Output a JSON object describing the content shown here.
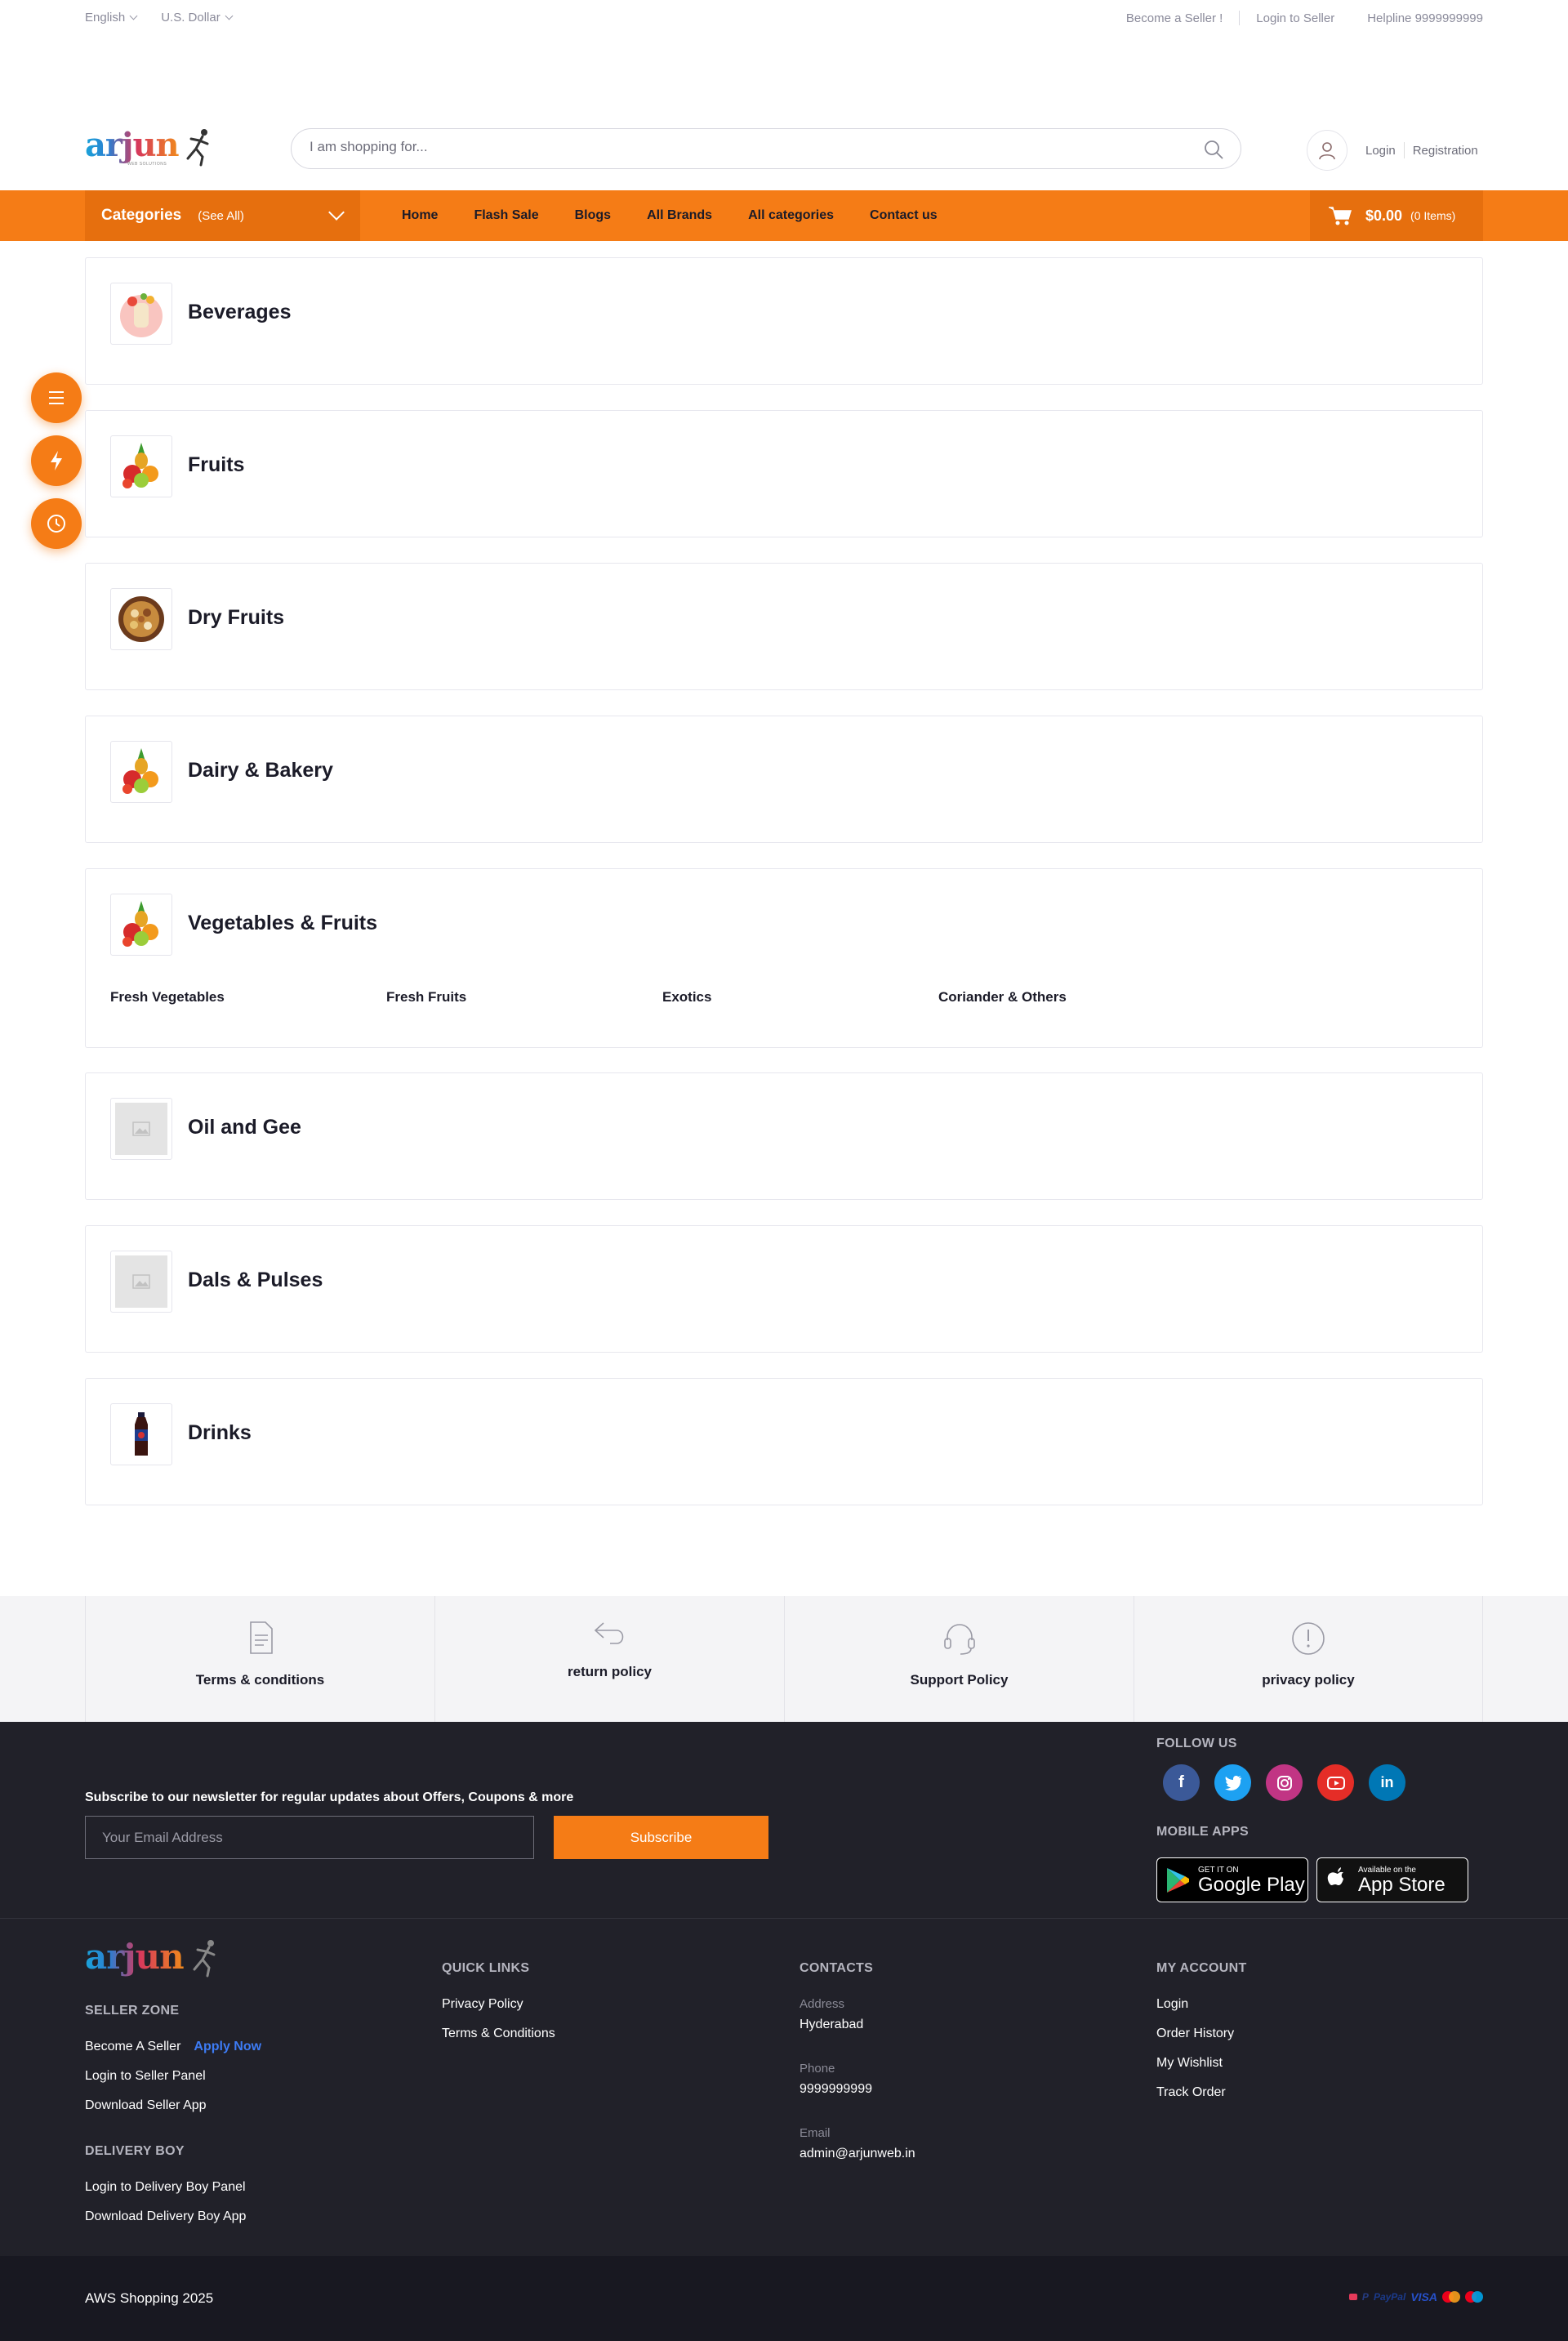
{
  "topbar": {
    "language": "English",
    "currency": "U.S. Dollar",
    "become_seller": "Become a Seller !",
    "login_seller": "Login to Seller",
    "helpline": "Helpline 9999999999"
  },
  "header": {
    "logo_text": "arjun",
    "logo_tagline": "WEB SOLUTIONS",
    "search_placeholder": "I am shopping for...",
    "login": "Login",
    "registration": "Registration"
  },
  "nav": {
    "categories": "Categories",
    "see_all": "(See All)",
    "links": [
      "Home",
      "Flash Sale",
      "Blogs",
      "All Brands",
      "All categories",
      "Contact us"
    ],
    "cart_amount": "$0.00",
    "cart_count": "(0 Items)"
  },
  "categories": [
    {
      "name": "Beverages",
      "icon": "beverages-image",
      "subs": []
    },
    {
      "name": "Fruits",
      "icon": "fruits-image",
      "subs": []
    },
    {
      "name": "Dry Fruits",
      "icon": "dry-fruits-image",
      "subs": []
    },
    {
      "name": "Dairy & Bakery",
      "icon": "fruits-image",
      "subs": []
    },
    {
      "name": "Vegetables & Fruits",
      "icon": "fruits-image",
      "subs": [
        "Fresh Vegetables",
        "Fresh Fruits",
        "Exotics",
        "Coriander & Others"
      ]
    },
    {
      "name": "Oil and Gee",
      "icon": "placeholder-image",
      "subs": []
    },
    {
      "name": "Dals & Pulses",
      "icon": "placeholder-image",
      "subs": []
    },
    {
      "name": "Drinks",
      "icon": "bottle-image",
      "subs": []
    }
  ],
  "policies": [
    "Terms & conditions",
    "return policy",
    "Support Policy",
    "privacy policy"
  ],
  "newsletter": {
    "title": "Subscribe to our newsletter for regular updates about Offers, Coupons & more",
    "placeholder": "Your Email Address",
    "button": "Subscribe"
  },
  "follow": {
    "title": "FOLLOW US",
    "networks": [
      "facebook",
      "twitter",
      "instagram",
      "youtube",
      "linkedin"
    ]
  },
  "apps": {
    "title": "MOBILE APPS",
    "google_small": "GET IT ON",
    "google_big": "Google Play",
    "apple_small": "Available on the",
    "apple_big": "App Store"
  },
  "footer": {
    "seller_zone": "SELLER ZONE",
    "become_seller": "Become A Seller",
    "apply_now": "Apply Now",
    "login_seller_panel": "Login to Seller Panel",
    "download_seller_app": "Download Seller App",
    "delivery_boy": "DELIVERY BOY",
    "login_delivery_panel": "Login to Delivery Boy Panel",
    "download_delivery_app": "Download Delivery Boy App",
    "quick_links": "QUICK LINKS",
    "privacy_policy": "Privacy Policy",
    "terms": "Terms & Conditions",
    "contacts": "CONTACTS",
    "address_label": "Address",
    "address": "Hyderabad",
    "phone_label": "Phone",
    "phone": "9999999999",
    "email_label": "Email",
    "email": "admin@arjunweb.in",
    "my_account": "MY ACCOUNT",
    "account_links": [
      "Login",
      "Order History",
      "My Wishlist",
      "Track Order"
    ]
  },
  "bottom": {
    "copyright": "AWS Shopping 2025",
    "paypal": "PayPal",
    "visa": "VISA"
  },
  "colors": {
    "accent": "#f57c16",
    "accent_dark": "#e66f0e",
    "footer_bg": "#212129"
  }
}
